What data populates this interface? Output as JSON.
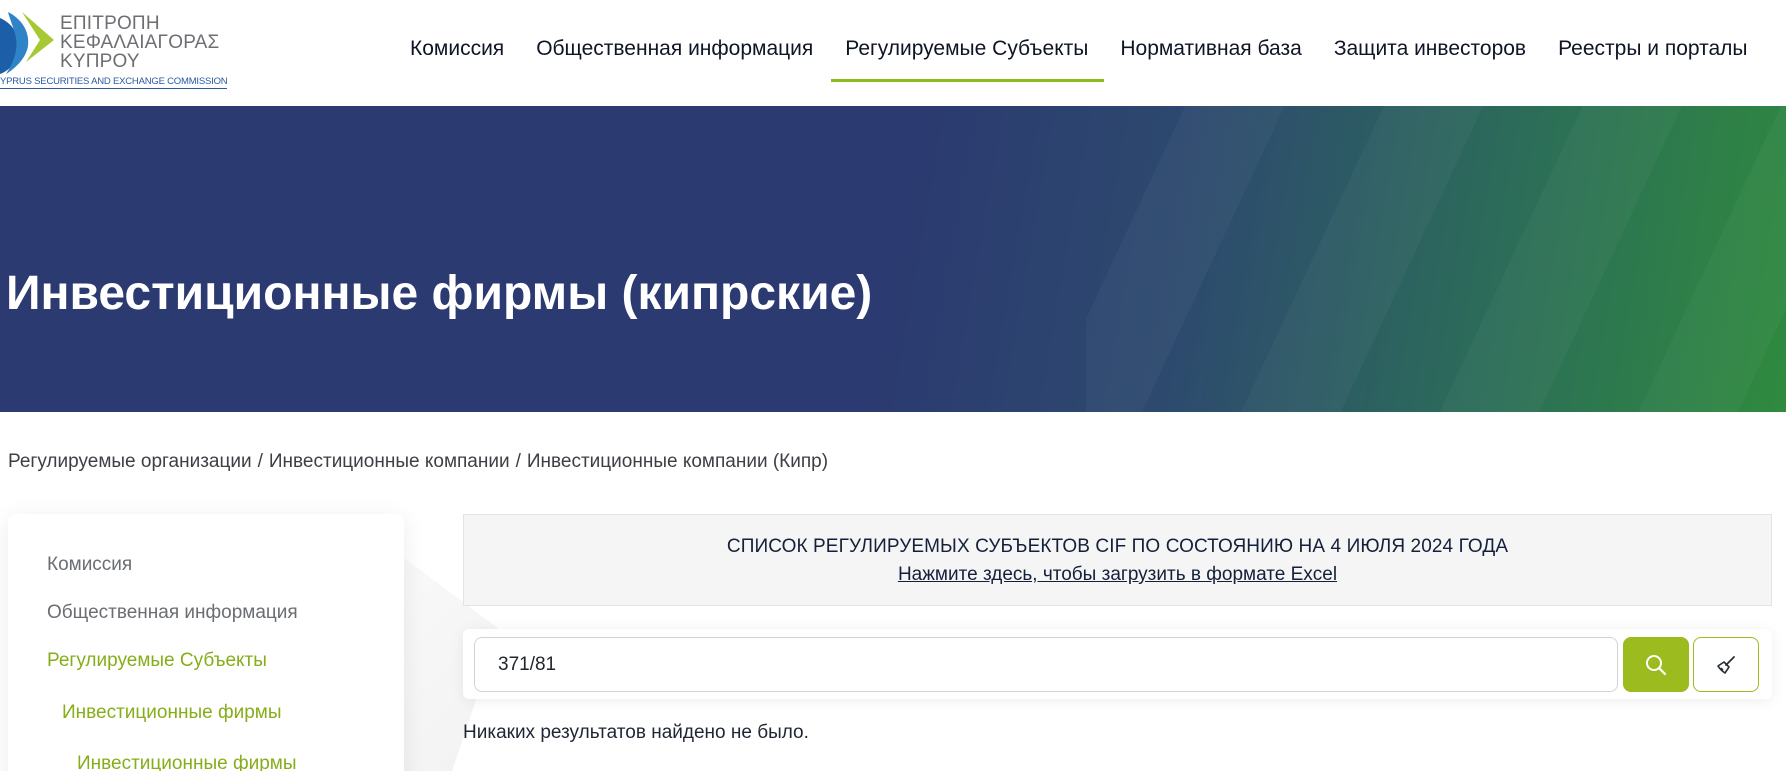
{
  "logo": {
    "line1": "ΕΠΙΤΡΟΠΗ",
    "line2": "ΚΕΦΑΛΑΙΑΓΟΡΑΣ",
    "line3": "ΚΥΠΡΟΥ",
    "subtitle": "YPRUS SECURITIES AND EXCHANGE COMMISSION"
  },
  "nav": {
    "items": [
      {
        "label": "Комиссия"
      },
      {
        "label": "Общественная информация"
      },
      {
        "label": "Регулируемые Субъекты"
      },
      {
        "label": "Нормативная база"
      },
      {
        "label": "Защита инвесторов"
      },
      {
        "label": "Реестры и порталы"
      }
    ],
    "active_index": 2
  },
  "hero": {
    "title": "Инвестиционные фирмы (кипрские)"
  },
  "breadcrumb": {
    "items": [
      "Регулируемые организации",
      "Инвестиционные компании",
      "Инвестиционные компании (Кипр)"
    ],
    "separator": "/"
  },
  "sidebar": {
    "items": [
      {
        "label": "Комиссия"
      },
      {
        "label": "Общественная информация"
      },
      {
        "label": "Регулируемые Субъекты"
      },
      {
        "label": "Инвестиционные фирмы"
      },
      {
        "label": "Инвестиционные фирмы"
      }
    ]
  },
  "notice": {
    "title": "СПИСОК РЕГУЛИРУЕМЫХ СУБЪЕКТОВ CIF ПО СОСТОЯНИЮ НА 4 ИЮЛЯ 2024 ГОДА",
    "link": "Нажмите здесь, чтобы загрузить в формате Excel"
  },
  "search": {
    "value": "371/81"
  },
  "results": {
    "message": "Никаких результатов найдено не было."
  },
  "colors": {
    "accent": "#9bbb1e",
    "hero_start": "#2b3a70",
    "hero_end": "#2f8a3e"
  }
}
